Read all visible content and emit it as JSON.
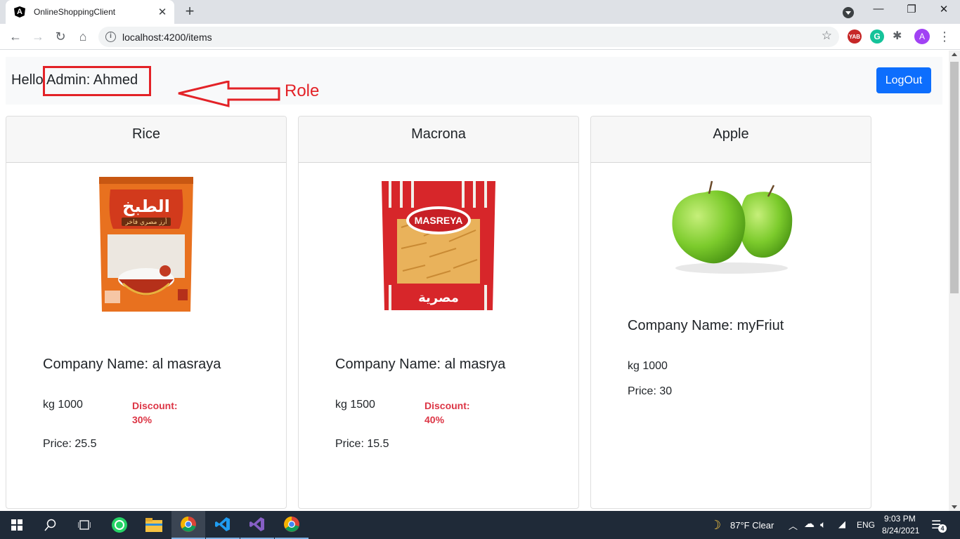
{
  "browser": {
    "tab_title": "OnlineShoppingClient",
    "favicon_letter": "A",
    "url": "localhost:4200/items",
    "profile_initial": "A",
    "extensions": [
      {
        "name": "yab-extension-icon",
        "label": "YAB",
        "color": "#c62828"
      },
      {
        "name": "grammarly-icon",
        "label": "G",
        "color": "#15c39a"
      }
    ]
  },
  "header": {
    "greeting": "Hello Admin: Ahmed",
    "annotation_label": "Role",
    "logout_label": "LogOut"
  },
  "products": [
    {
      "name": "Rice",
      "company": "Company Name: al masraya",
      "weight": "kg 1000",
      "discount_label": "Discount:",
      "discount_value": "30%",
      "price": "Price: 25.5"
    },
    {
      "name": "Macrona",
      "company": "Company Name: al masrya",
      "weight": "kg 1500",
      "discount_label": "Discount:",
      "discount_value": "40%",
      "price": "Price: 15.5"
    },
    {
      "name": "Apple",
      "company": "Company Name: myFriut",
      "weight": "kg 1000",
      "price": "Price: 30"
    }
  ],
  "package_text": {
    "rice_brand": "الطبخ",
    "rice_sub": "أرز مصري فاخر",
    "pasta_brand": "MASREYA",
    "pasta_sub": "مصرية"
  },
  "taskbar": {
    "weather": "87°F  Clear",
    "language": "ENG",
    "time": "9:03 PM",
    "date": "8/24/2021",
    "notification_count": "4"
  },
  "colors": {
    "accent": "#0d6efd",
    "annotation": "#e32227",
    "discount": "#dc3545"
  }
}
